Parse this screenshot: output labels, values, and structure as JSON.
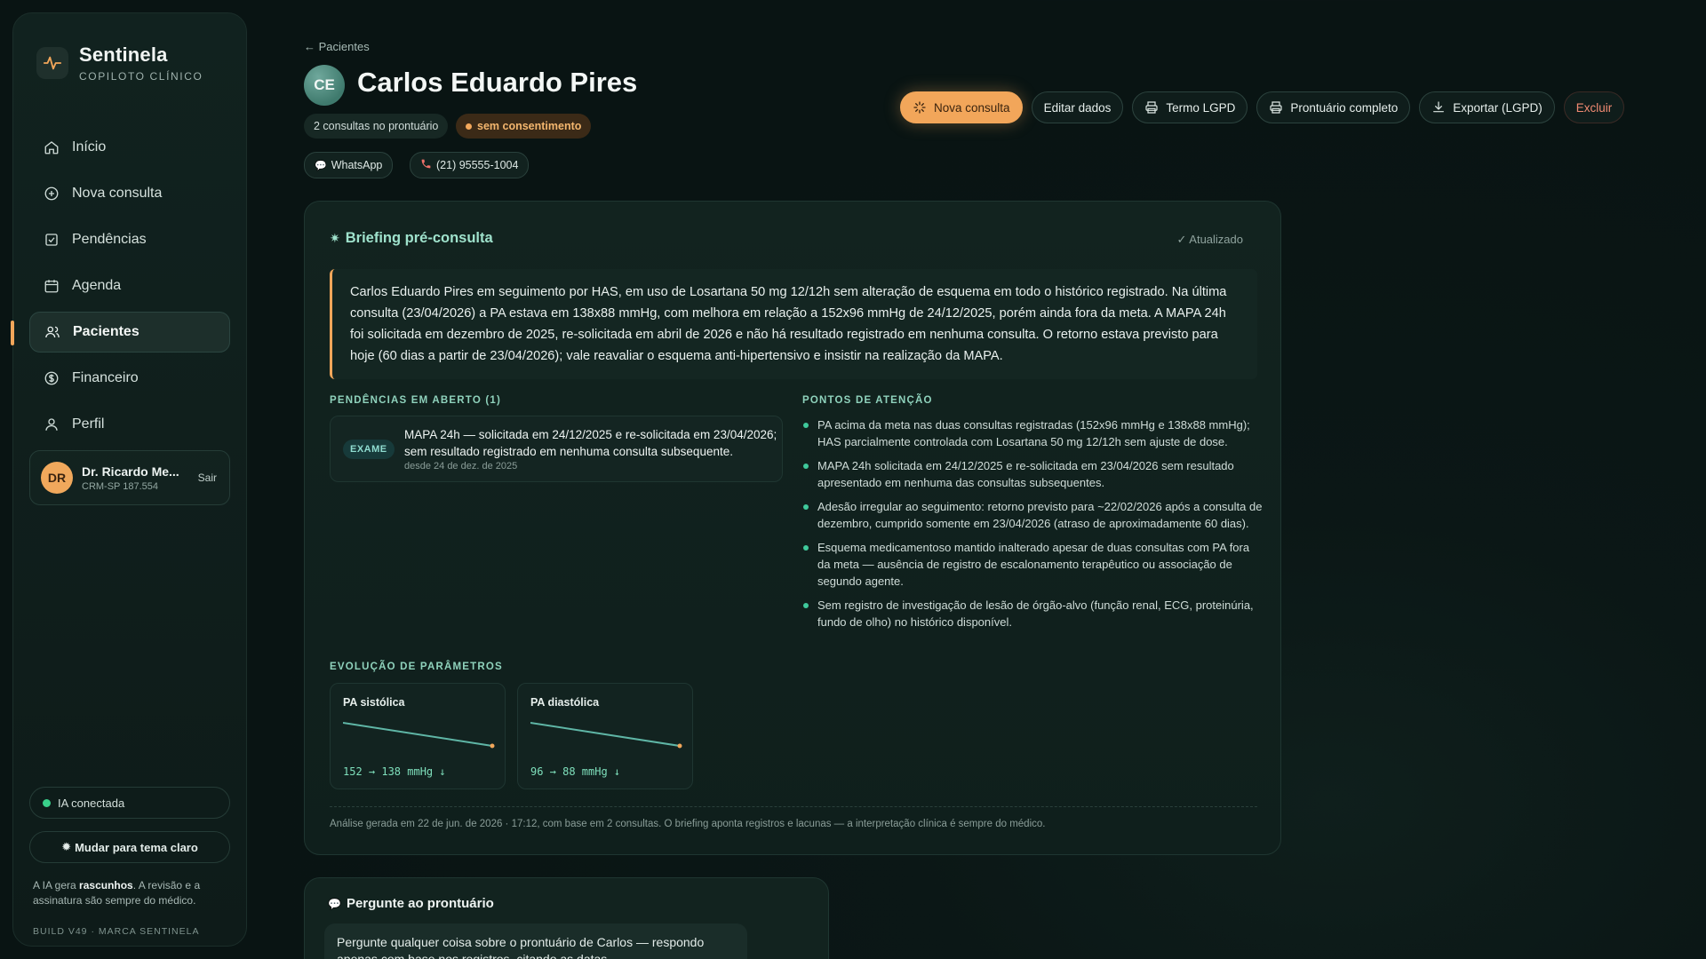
{
  "brand": {
    "name": "Sentinela",
    "subtitle": "COPILOTO CLÍNICO"
  },
  "sidebar": {
    "items": [
      {
        "label": "Início",
        "icon": "home-icon"
      },
      {
        "label": "Nova consulta",
        "icon": "plus-circle-icon"
      },
      {
        "label": "Pendências",
        "icon": "checklist-icon"
      },
      {
        "label": "Agenda",
        "icon": "calendar-icon"
      },
      {
        "label": "Pacientes",
        "icon": "users-icon",
        "active": true
      },
      {
        "label": "Financeiro",
        "icon": "dollar-icon"
      },
      {
        "label": "Perfil",
        "icon": "user-icon"
      }
    ],
    "user": {
      "initials": "DR",
      "name": "Dr. Ricardo Me...",
      "crm": "CRM-SP 187.554",
      "logout": "Sair"
    },
    "ia_status": "IA conectada",
    "theme_button": "Mudar para tema claro",
    "note_prefix": "A IA gera ",
    "note_bold": "rascunhos",
    "note_suffix": ". A revisão e a assinatura são sempre do médico.",
    "build": "BUILD V49 · MARCA SENTINELA"
  },
  "header": {
    "back": "← Pacientes",
    "initials": "CE",
    "patient_name": "Carlos Eduardo Pires",
    "consultas_chip": "2 consultas no prontuário",
    "consent_chip": "sem consentimento",
    "whatsapp": "WhatsApp",
    "phone": "(21) 95555-1004"
  },
  "actions": {
    "nova_consulta": "Nova consulta",
    "editar": "Editar dados",
    "termo": "Termo LGPD",
    "prontuario": "Prontuário completo",
    "exportar": "Exportar (LGPD)",
    "excluir": "Excluir"
  },
  "briefing": {
    "title": "Briefing pré-consulta",
    "status": "✓ Atualizado",
    "summary": "Carlos Eduardo Pires em seguimento por HAS, em uso de Losartana 50 mg 12/12h sem alteração de esquema em todo o histórico registrado. Na última consulta (23/04/2026) a PA estava em 138x88 mmHg, com melhora em relação a 152x96 mmHg de 24/12/2025, porém ainda fora da meta. A MAPA 24h foi solicitada em dezembro de 2025, re-solicitada em abril de 2026 e não há resultado registrado em nenhuma consulta. O retorno estava previsto para hoje (60 dias a partir de 23/04/2026); vale reavaliar o esquema anti-hipertensivo e insistir na realização da MAPA.",
    "pend_label": "PENDÊNCIAS EM ABERTO (1)",
    "pend": {
      "badge": "EXAME",
      "text": "MAPA 24h — solicitada em 24/12/2025 e re-solicitada em 23/04/2026; sem resultado registrado em nenhuma consulta subsequente.",
      "since": "desde 24 de dez. de 2025"
    },
    "attn_label": "PONTOS DE ATENÇÃO",
    "attn": [
      "PA acima da meta nas duas consultas registradas (152x96 mmHg e 138x88 mmHg); HAS parcialmente controlada com Losartana 50 mg 12/12h sem ajuste de dose.",
      "MAPA 24h solicitada em 24/12/2025 e re-solicitada em 23/04/2026 sem resultado apresentado em nenhuma das consultas subsequentes.",
      "Adesão irregular ao seguimento: retorno previsto para ~22/02/2026 após a consulta de dezembro, cumprido somente em 23/04/2026 (atraso de aproximadamente 60 dias).",
      "Esquema medicamentoso mantido inalterado apesar de duas consultas com PA fora da meta — ausência de registro de escalonamento terapêutico ou associação de segundo agente.",
      "Sem registro de investigação de lesão de órgão-alvo (função renal, ECG, proteinúria, fundo de olho) no histórico disponível."
    ],
    "evol_label": "EVOLUÇÃO DE PARÂMETROS",
    "params": [
      {
        "title": "PA sistólica",
        "from": 152,
        "to": 138,
        "summary": "152 → 138 mmHg ↓"
      },
      {
        "title": "PA diastólica",
        "from": 96,
        "to": 88,
        "summary": "96 → 88 mmHg ↓"
      }
    ],
    "footnote": "Análise gerada em 22 de jun. de 2026 · 17:12, com base em 2 consultas. O briefing aponta registros e lacunas — a interpretação clínica é sempre do médico."
  },
  "ask": {
    "title": "Pergunte ao prontuário",
    "bubble": "Pergunte qualquer coisa sobre o prontuário de Carlos — respondo apenas com base nos registros, citando as datas."
  },
  "colors": {
    "accent": "#f2a65a",
    "mint": "#9fe2cc",
    "danger": "#f08a72",
    "success": "#39d08a"
  }
}
